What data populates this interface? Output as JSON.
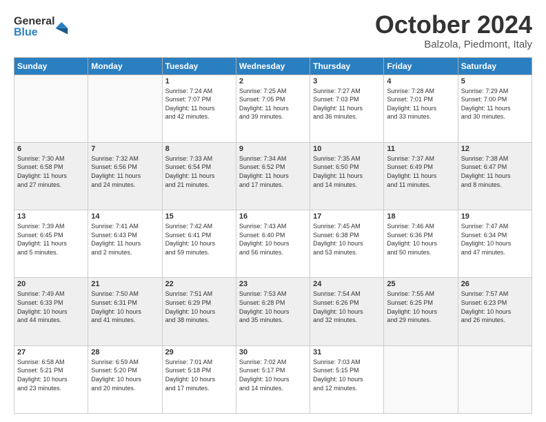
{
  "header": {
    "logo_general": "General",
    "logo_blue": "Blue",
    "title": "October 2024",
    "location": "Balzola, Piedmont, Italy"
  },
  "weekdays": [
    "Sunday",
    "Monday",
    "Tuesday",
    "Wednesday",
    "Thursday",
    "Friday",
    "Saturday"
  ],
  "weeks": [
    [
      {
        "day": "",
        "info": ""
      },
      {
        "day": "",
        "info": ""
      },
      {
        "day": "1",
        "info": "Sunrise: 7:24 AM\nSunset: 7:07 PM\nDaylight: 11 hours\nand 42 minutes."
      },
      {
        "day": "2",
        "info": "Sunrise: 7:25 AM\nSunset: 7:05 PM\nDaylight: 11 hours\nand 39 minutes."
      },
      {
        "day": "3",
        "info": "Sunrise: 7:27 AM\nSunset: 7:03 PM\nDaylight: 11 hours\nand 36 minutes."
      },
      {
        "day": "4",
        "info": "Sunrise: 7:28 AM\nSunset: 7:01 PM\nDaylight: 11 hours\nand 33 minutes."
      },
      {
        "day": "5",
        "info": "Sunrise: 7:29 AM\nSunset: 7:00 PM\nDaylight: 11 hours\nand 30 minutes."
      }
    ],
    [
      {
        "day": "6",
        "info": "Sunrise: 7:30 AM\nSunset: 6:58 PM\nDaylight: 11 hours\nand 27 minutes."
      },
      {
        "day": "7",
        "info": "Sunrise: 7:32 AM\nSunset: 6:56 PM\nDaylight: 11 hours\nand 24 minutes."
      },
      {
        "day": "8",
        "info": "Sunrise: 7:33 AM\nSunset: 6:54 PM\nDaylight: 11 hours\nand 21 minutes."
      },
      {
        "day": "9",
        "info": "Sunrise: 7:34 AM\nSunset: 6:52 PM\nDaylight: 11 hours\nand 17 minutes."
      },
      {
        "day": "10",
        "info": "Sunrise: 7:35 AM\nSunset: 6:50 PM\nDaylight: 11 hours\nand 14 minutes."
      },
      {
        "day": "11",
        "info": "Sunrise: 7:37 AM\nSunset: 6:49 PM\nDaylight: 11 hours\nand 11 minutes."
      },
      {
        "day": "12",
        "info": "Sunrise: 7:38 AM\nSunset: 6:47 PM\nDaylight: 11 hours\nand 8 minutes."
      }
    ],
    [
      {
        "day": "13",
        "info": "Sunrise: 7:39 AM\nSunset: 6:45 PM\nDaylight: 11 hours\nand 5 minutes."
      },
      {
        "day": "14",
        "info": "Sunrise: 7:41 AM\nSunset: 6:43 PM\nDaylight: 11 hours\nand 2 minutes."
      },
      {
        "day": "15",
        "info": "Sunrise: 7:42 AM\nSunset: 6:41 PM\nDaylight: 10 hours\nand 59 minutes."
      },
      {
        "day": "16",
        "info": "Sunrise: 7:43 AM\nSunset: 6:40 PM\nDaylight: 10 hours\nand 56 minutes."
      },
      {
        "day": "17",
        "info": "Sunrise: 7:45 AM\nSunset: 6:38 PM\nDaylight: 10 hours\nand 53 minutes."
      },
      {
        "day": "18",
        "info": "Sunrise: 7:46 AM\nSunset: 6:36 PM\nDaylight: 10 hours\nand 50 minutes."
      },
      {
        "day": "19",
        "info": "Sunrise: 7:47 AM\nSunset: 6:34 PM\nDaylight: 10 hours\nand 47 minutes."
      }
    ],
    [
      {
        "day": "20",
        "info": "Sunrise: 7:49 AM\nSunset: 6:33 PM\nDaylight: 10 hours\nand 44 minutes."
      },
      {
        "day": "21",
        "info": "Sunrise: 7:50 AM\nSunset: 6:31 PM\nDaylight: 10 hours\nand 41 minutes."
      },
      {
        "day": "22",
        "info": "Sunrise: 7:51 AM\nSunset: 6:29 PM\nDaylight: 10 hours\nand 38 minutes."
      },
      {
        "day": "23",
        "info": "Sunrise: 7:53 AM\nSunset: 6:28 PM\nDaylight: 10 hours\nand 35 minutes."
      },
      {
        "day": "24",
        "info": "Sunrise: 7:54 AM\nSunset: 6:26 PM\nDaylight: 10 hours\nand 32 minutes."
      },
      {
        "day": "25",
        "info": "Sunrise: 7:55 AM\nSunset: 6:25 PM\nDaylight: 10 hours\nand 29 minutes."
      },
      {
        "day": "26",
        "info": "Sunrise: 7:57 AM\nSunset: 6:23 PM\nDaylight: 10 hours\nand 26 minutes."
      }
    ],
    [
      {
        "day": "27",
        "info": "Sunrise: 6:58 AM\nSunset: 5:21 PM\nDaylight: 10 hours\nand 23 minutes."
      },
      {
        "day": "28",
        "info": "Sunrise: 6:59 AM\nSunset: 5:20 PM\nDaylight: 10 hours\nand 20 minutes."
      },
      {
        "day": "29",
        "info": "Sunrise: 7:01 AM\nSunset: 5:18 PM\nDaylight: 10 hours\nand 17 minutes."
      },
      {
        "day": "30",
        "info": "Sunrise: 7:02 AM\nSunset: 5:17 PM\nDaylight: 10 hours\nand 14 minutes."
      },
      {
        "day": "31",
        "info": "Sunrise: 7:03 AM\nSunset: 5:15 PM\nDaylight: 10 hours\nand 12 minutes."
      },
      {
        "day": "",
        "info": ""
      },
      {
        "day": "",
        "info": ""
      }
    ]
  ]
}
